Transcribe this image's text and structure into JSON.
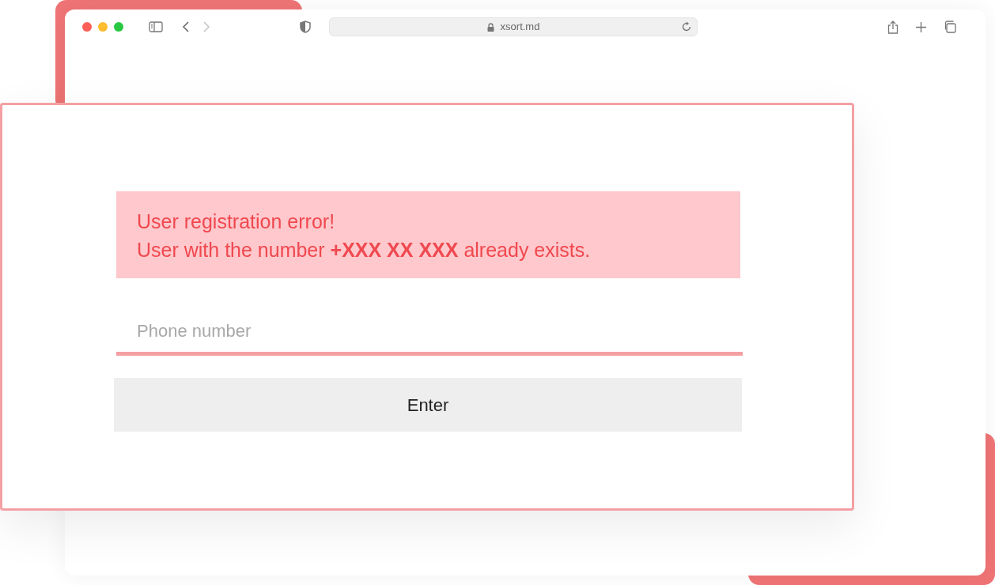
{
  "browser": {
    "url": "xsort.md",
    "nav": [
      {
        "kind": "back",
        "disabled": false
      },
      {
        "kind": "forward",
        "disabled": true
      }
    ]
  },
  "alert": {
    "lines": [
      "User registration error!",
      "User with the number **+XXX XX XXX** already exists."
    ]
  },
  "phone_field": {
    "placeholder": "Phone number"
  },
  "button": {
    "label": "Enter"
  }
}
